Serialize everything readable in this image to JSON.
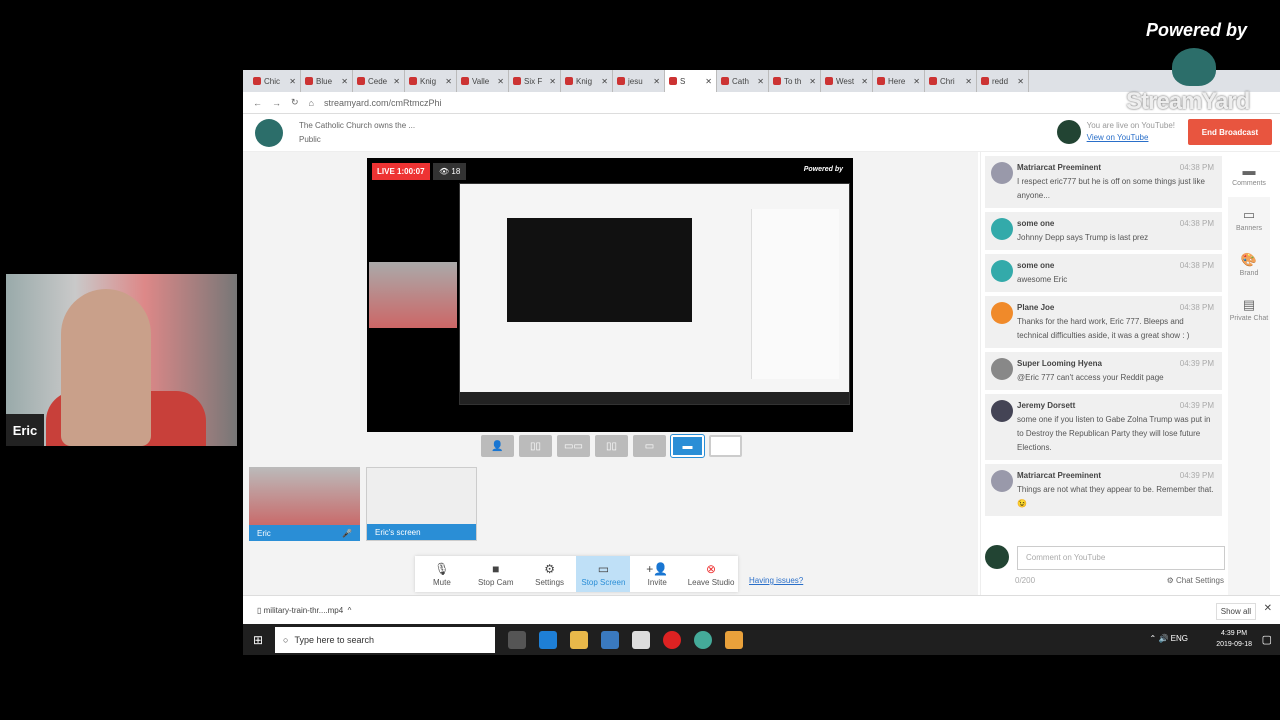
{
  "overlay": {
    "powered_by": "Powered by",
    "brand": "StreamYard",
    "webcam_name": "Eric"
  },
  "browser": {
    "tabs": [
      "Chic",
      "Blue",
      "Cede",
      "Knig",
      "Valle",
      "Six F",
      "Knig",
      "jesu",
      "S",
      "Cath",
      "To th",
      "West",
      "Here",
      "Chri",
      "redd"
    ],
    "active_tab": 8,
    "url": "streamyard.com/cmRtmczPhi"
  },
  "header": {
    "title": "The Catholic Church owns the ...",
    "privacy": "Public",
    "live_text": "You are live on YouTube!",
    "view_link": "View on YouTube",
    "end_button": "End Broadcast"
  },
  "stage": {
    "live_label": "LIVE 1:00:07",
    "viewers": "18",
    "powered": "Powered by"
  },
  "thumbs": [
    {
      "label": "Eric"
    },
    {
      "label": "Eric's screen"
    }
  ],
  "toolbar": {
    "items": [
      {
        "label": "Mute",
        "icon": "microphone-icon"
      },
      {
        "label": "Stop Cam",
        "icon": "camera-icon"
      },
      {
        "label": "Settings",
        "icon": "gear-icon"
      },
      {
        "label": "Stop Screen",
        "icon": "monitor-icon"
      },
      {
        "label": "Invite",
        "icon": "add-person-icon"
      },
      {
        "label": "Leave Studio",
        "icon": "close-circle-icon"
      }
    ],
    "issues": "Having issues?"
  },
  "chat": {
    "messages": [
      {
        "name": "Matriarcat Preeminent",
        "time": "04:38 PM",
        "text": "I respect eric777 but he is off on some things just like anyone..."
      },
      {
        "name": "some one",
        "time": "04:38 PM",
        "text": "Johnny Depp says Trump is last prez"
      },
      {
        "name": "some one",
        "time": "04:38 PM",
        "text": "awesome Eric"
      },
      {
        "name": "Plane Joe",
        "time": "04:38 PM",
        "text": "Thanks for the hard work, Eric 777. Bleeps and technical difficulties aside, it was a great show : )"
      },
      {
        "name": "Super Looming Hyena",
        "time": "04:39 PM",
        "text": "@Eric 777 can't access your Reddit page"
      },
      {
        "name": "Jeremy Dorsett",
        "time": "04:39 PM",
        "text": "some one if you listen to Gabe Zolna Trump was put in to Destroy the Republican Party they will lose future Elections."
      },
      {
        "name": "Matriarcat Preeminent",
        "time": "04:39 PM",
        "text": "Things are not what they appear to be. Remember that.😉"
      }
    ],
    "placeholder": "Comment on YouTube",
    "count": "0/200",
    "settings": "Chat Settings"
  },
  "side": [
    "Comments",
    "Banners",
    "Brand",
    "Private Chat"
  ],
  "download": {
    "file": "military-train-thr....mp4",
    "show_all": "Show all"
  },
  "taskbar": {
    "search_placeholder": "Type here to search",
    "lang": "ENG",
    "time": "4:39 PM",
    "date": "2019-09-18"
  },
  "colors": {
    "accent": "#2a8ed6",
    "end": "#e8553f",
    "live": "#e33333"
  }
}
